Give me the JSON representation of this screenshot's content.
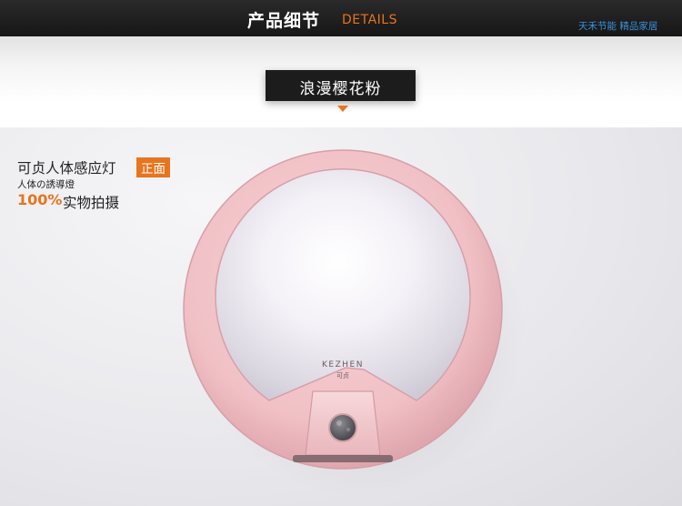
{
  "header": {
    "title": "产品细节",
    "subtitle": "DETAILS",
    "brand": "天禾节能 精品家居"
  },
  "tag": {
    "label": "浪漫樱花粉"
  },
  "info": {
    "title": "可贞人体感应灯",
    "badge": "正面",
    "subtitle": "人体の誘導燈",
    "percent": "100%",
    "real_shot": "实物拍摄"
  },
  "product": {
    "logo_text": "KEZHEN",
    "logo_sub": "可贞"
  },
  "colors": {
    "accent": "#e8741e",
    "header_bg": "#1c1c1c",
    "lamp_pink": "#f2c4c9",
    "brand_blue": "#3b8fd8"
  }
}
